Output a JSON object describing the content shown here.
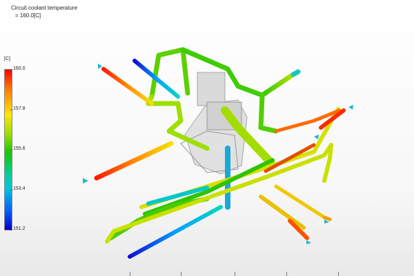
{
  "result": {
    "title": "Circuit coolant temperature",
    "value": "= 160.0[C]"
  },
  "legend": {
    "unit": "[C]",
    "ticks": [
      "160.0",
      "157.8",
      "155.6",
      "153.4",
      "151.2"
    ],
    "colors": {
      "max": "#ff0000",
      "upper": "#ffe600",
      "mid": "#19c800",
      "lower": "#00c8e0",
      "min": "#0000c8"
    }
  },
  "icons": {
    "inlet_marker": "coolant-inlet-arrow-icon"
  }
}
